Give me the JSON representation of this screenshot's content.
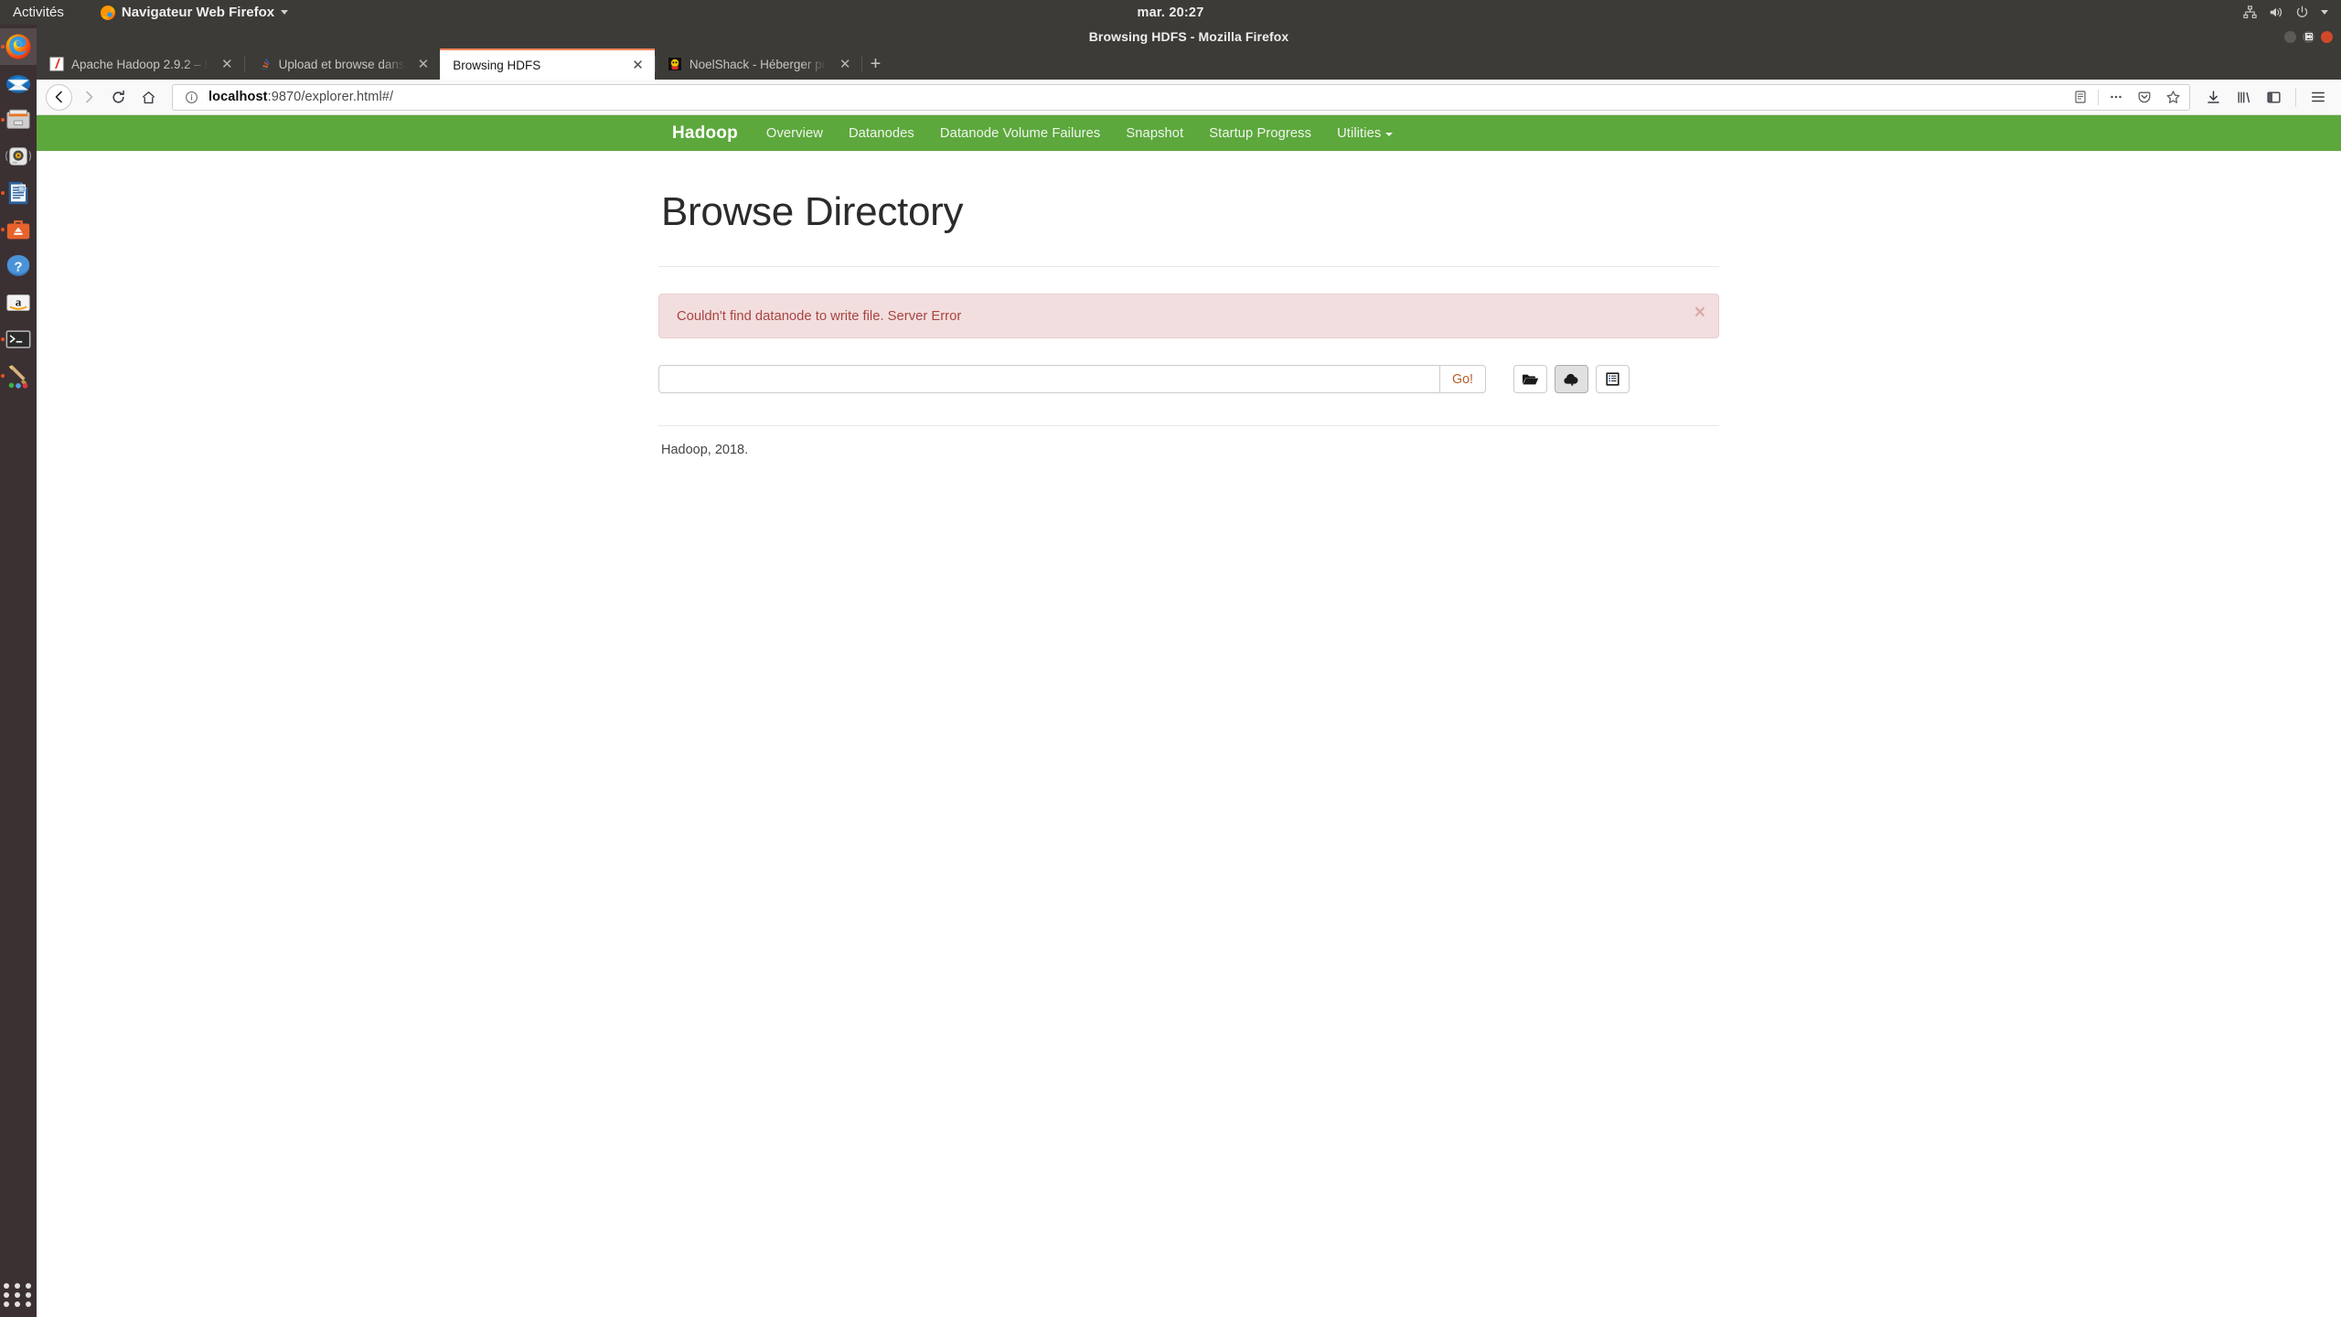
{
  "desktop": {
    "activities_label": "Activités",
    "app_menu_label": "Navigateur Web Firefox",
    "clock": "mar. 20:27",
    "tray_icons": [
      "network-icon",
      "volume-icon",
      "power-icon",
      "chevron-down-icon"
    ],
    "dock_items": [
      {
        "name": "firefox",
        "label": "Firefox",
        "running": true,
        "active": true
      },
      {
        "name": "thunderbird",
        "label": "Thunderbird",
        "running": false,
        "active": false
      },
      {
        "name": "files",
        "label": "Fichiers",
        "running": true,
        "active": false
      },
      {
        "name": "rhythmbox",
        "label": "Rhythmbox",
        "running": false,
        "active": false
      },
      {
        "name": "libreoffice-writer",
        "label": "LibreOffice Writer",
        "running": true,
        "active": false
      },
      {
        "name": "ubuntu-software",
        "label": "Logiciels Ubuntu",
        "running": true,
        "active": false
      },
      {
        "name": "help",
        "label": "Aide",
        "running": false,
        "active": false
      },
      {
        "name": "amazon",
        "label": "Amazon",
        "running": false,
        "active": false
      },
      {
        "name": "terminal",
        "label": "Terminal",
        "running": true,
        "active": false
      },
      {
        "name": "gimp",
        "label": "GIMP",
        "running": true,
        "active": false
      }
    ],
    "show_apps_label": "Afficher les applications"
  },
  "browser": {
    "window_title": "Browsing HDFS - Mozilla Firefox",
    "window_controls": [
      "minimize",
      "maximize",
      "close"
    ],
    "tabs": [
      {
        "title": "Apache Hadoop 2.9.2 – H",
        "favicon": "hadoop-doc-icon",
        "selected": false
      },
      {
        "title": "Upload et browse dans ",
        "favicon": "stackoverflow-icon",
        "selected": false
      },
      {
        "title": "Browsing HDFS",
        "favicon": "none",
        "selected": true
      },
      {
        "title": "NoelShack - Héberger pu",
        "favicon": "noelshack-icon",
        "selected": false
      }
    ],
    "new_tab_label": "+",
    "nav_buttons": [
      "back-icon",
      "forward-icon",
      "reload-icon",
      "home-icon"
    ],
    "url": {
      "host": "localhost",
      "rest": ":9870/explorer.html#/",
      "full": "localhost:9870/explorer.html#/",
      "identity_icon": "info-circle-icon"
    },
    "urlbar_icons": [
      "reader-mode-icon",
      "page-actions-icon",
      "pocket-icon",
      "bookmark-star-icon"
    ],
    "toolbar_icons": [
      "downloads-icon",
      "library-icon",
      "sidebar-icon",
      "hamburger-menu-icon"
    ]
  },
  "hadoop": {
    "brand": "Hadoop",
    "brand_color": "#5da83d",
    "nav_items": [
      {
        "label": "Overview",
        "has_caret": false
      },
      {
        "label": "Datanodes",
        "has_caret": false
      },
      {
        "label": "Datanode Volume Failures",
        "has_caret": false
      },
      {
        "label": "Snapshot",
        "has_caret": false
      },
      {
        "label": "Startup Progress",
        "has_caret": false
      },
      {
        "label": "Utilities",
        "has_caret": true
      }
    ],
    "page_title": "Browse Directory",
    "alert": {
      "message": "Couldn't find datanode to write file. Server Error",
      "close_label": "×",
      "bg_color": "#f2dede",
      "border_color": "#ebccd1",
      "text_color": "#a94442"
    },
    "path_input": {
      "value": "",
      "placeholder": ""
    },
    "go_button_label": "Go!",
    "action_buttons": [
      {
        "name": "create-directory-button",
        "icon": "folder-open-icon",
        "pressed": false
      },
      {
        "name": "upload-files-button",
        "icon": "cloud-upload-icon",
        "pressed": true
      },
      {
        "name": "cut-paste-button",
        "icon": "clipboard-list-icon",
        "pressed": false
      }
    ],
    "footer": "Hadoop, 2018."
  }
}
